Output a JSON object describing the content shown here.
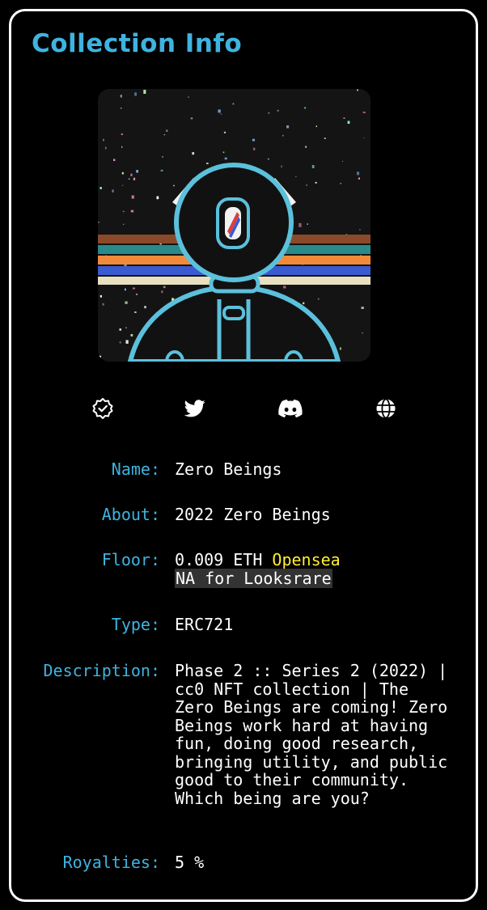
{
  "panel": {
    "title": "Collection Info"
  },
  "links": [
    {
      "icon": "verified-badge-icon"
    },
    {
      "icon": "twitter-icon"
    },
    {
      "icon": "discord-icon"
    },
    {
      "icon": "globe-icon"
    }
  ],
  "details": {
    "name_label": "Name:",
    "name_value": "Zero Beings",
    "about_label": "About:",
    "about_value": "2022 Zero Beings",
    "floor_label": "Floor:",
    "floor_value": "0.009 ETH",
    "floor_source": "Opensea",
    "floor_looksrare": "NA for Looksrare",
    "type_label": "Type:",
    "type_value": "ERC721",
    "description_label": "Description:",
    "description_value": "Phase 2 :: Series 2 (2022) | cc0 NFT collection | The Zero Beings are coming! Zero Beings work hard at having fun, doing good research, bringing utility, and public good to their community. Which being are you?",
    "royalties_label": "Royalties:",
    "royalties_value": "5 %"
  },
  "colors": {
    "accent": "#3fb3e0",
    "highlight": "#ffee33",
    "background": "#000000",
    "text": "#ffffff"
  }
}
